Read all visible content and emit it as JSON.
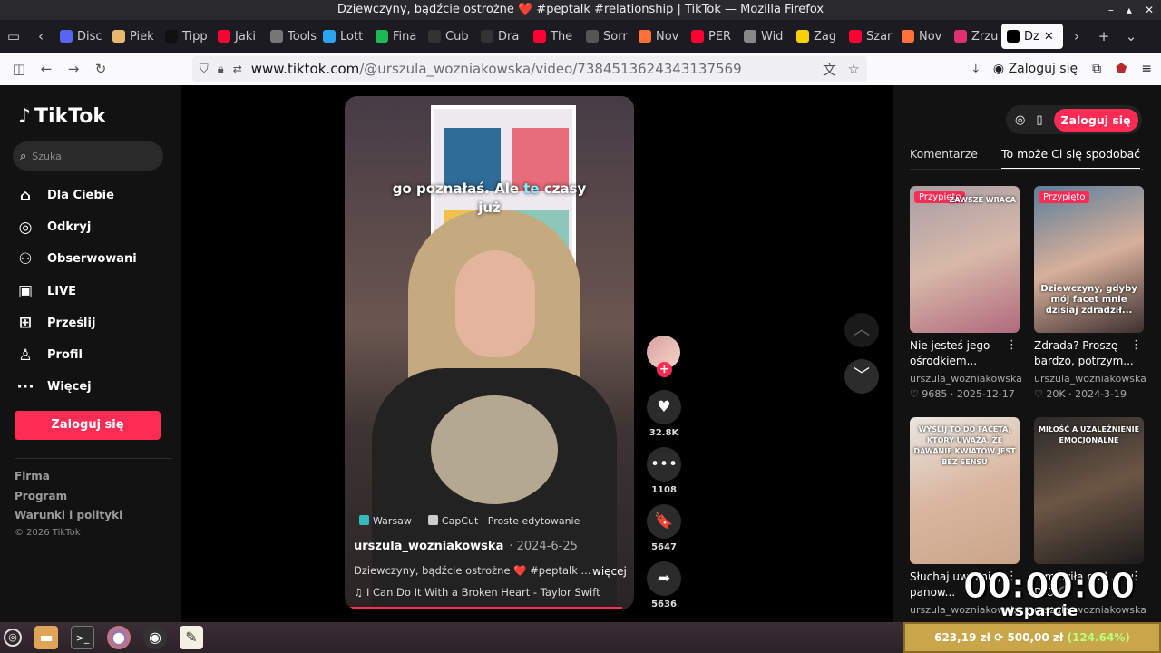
{
  "window": {
    "title": "Dziewczyny, bądźcie ostrożne ❤️ #peptalk #relationship | TikTok — Mozilla Firefox"
  },
  "tabs": [
    {
      "label": "Disc",
      "color": "#5865f2"
    },
    {
      "label": "Piek",
      "color": "#e8b86d"
    },
    {
      "label": "Tipp",
      "color": "#111111"
    },
    {
      "label": "Jaki",
      "color": "#ff0033"
    },
    {
      "label": "Tools,",
      "color": "#777777"
    },
    {
      "label": "Lott",
      "color": "#2aa4ef"
    },
    {
      "label": "Fina",
      "color": "#1db954"
    },
    {
      "label": "Cub",
      "color": "#333333"
    },
    {
      "label": "Dra",
      "color": "#333333"
    },
    {
      "label": "The",
      "color": "#ff0033"
    },
    {
      "label": "Sorr",
      "color": "#555555"
    },
    {
      "label": "Nov",
      "color": "#ff7139"
    },
    {
      "label": "PER",
      "color": "#ff0033"
    },
    {
      "label": "Wid",
      "color": "#888888"
    },
    {
      "label": "Zag",
      "color": "#f5d10a"
    },
    {
      "label": "Szar",
      "color": "#ff0033"
    },
    {
      "label": "Nov",
      "color": "#ff7139"
    },
    {
      "label": "Zrzu",
      "color": "#e0306d"
    },
    {
      "label": "Dz",
      "color": "#000000"
    }
  ],
  "nav": {
    "url_host": "www.tiktok.com",
    "url_path": "/@urszula_wozniakowska/video/7384513624343137569",
    "login": "Zaloguj się"
  },
  "sidebar": {
    "logo": "TikTok",
    "search_placeholder": "Szukaj",
    "items": [
      {
        "icon": "⌂",
        "label": "Dla Ciebie"
      },
      {
        "icon": "◎",
        "label": "Odkryj"
      },
      {
        "icon": "⚇",
        "label": "Obserwowani"
      },
      {
        "icon": "▣",
        "label": "LIVE"
      },
      {
        "icon": "⊞",
        "label": "Prześlij"
      },
      {
        "icon": "♙",
        "label": "Profil"
      },
      {
        "icon": "···",
        "label": "Więcej"
      }
    ],
    "login": "Zaloguj się",
    "links": [
      "Firma",
      "Program",
      "Warunki i polityki"
    ],
    "copyright": "© 2026 TikTok"
  },
  "video": {
    "caption_pre": "go poznałaś. Ale ",
    "caption_hi": "te",
    "caption_post": " czasy",
    "caption_line2": "już",
    "location": "Warsaw",
    "capcut": "CapCut · Proste edytowanie",
    "user": "urszula_wozniakowska",
    "date": "· 2024-6-25",
    "desc": "Dziewczyny, bądźcie ostrożne ❤️ #peptalk ...",
    "more": "więcej",
    "music": "♫  I Can Do It With a Broken Heart - Taylor Swift"
  },
  "actions": [
    {
      "name": "like",
      "icon": "♥",
      "count": "32.8K"
    },
    {
      "name": "comment",
      "icon": "•••",
      "count": "1108"
    },
    {
      "name": "save",
      "icon": "🔖",
      "count": "5647"
    },
    {
      "name": "share",
      "icon": "➦",
      "count": "5636"
    }
  ],
  "right": {
    "login": "Zaloguj się",
    "tab_comments": "Komentarze",
    "tab_like": "To może Ci się spodobać",
    "cards": [
      {
        "pinned": "Przypięto",
        "overlay": "ZAWSZE WRACA",
        "title": "Nie jesteś jego ośrodkiem...",
        "user": "urszula_wozniakowska",
        "likes": "9685",
        "date": "2025-12-17",
        "bg": "linear-gradient(160deg,#a89da6,#d7b9a8 50%,#b06a7e)"
      },
      {
        "pinned": "Przypięto",
        "overlay": "Dziewczyny, gdyby mój facet mnie dzisiaj zdradził...",
        "title": "Zdrada? Proszę bardzo, potrzym...",
        "user": "urszula_wozniakowska",
        "likes": "20K",
        "date": "2024-3-19",
        "bg": "linear-gradient(160deg,#5b7e9a,#d8b09b 50%,#3d3030)"
      },
      {
        "pinned": "",
        "overlay": "WYŚLIJ TO DO FACETA, KTÓRY UWAŻA, ŻE DAWANIE KWIATÓW JEST BEZ SENSU",
        "title": "Słuchaj uważnie, panow...",
        "user": "urszula_wozniakowska",
        "likes": "",
        "date": "",
        "bg": "linear-gradient(160deg,#e9e6e0,#d9b7a0 50%,#caa58a)"
      },
      {
        "pinned": "",
        "overlay": "MIŁOŚĆ A UZALEŻNIENIE EMOCJONALNE",
        "title": "...mówiła pod ... w D.O 🎧",
        "user": "urszula_wozniakowska",
        "likes": "",
        "date": "",
        "bg": "linear-gradient(160deg,#2a2a2a,#6b5644 50%,#1c1c1c)"
      }
    ]
  },
  "overlay": {
    "timer": "00:00:00",
    "wsparcie": "wsparcie",
    "donation_main": "623,19 zł ⟳ 500,00 zł",
    "donation_pct": "(124.64%)"
  }
}
